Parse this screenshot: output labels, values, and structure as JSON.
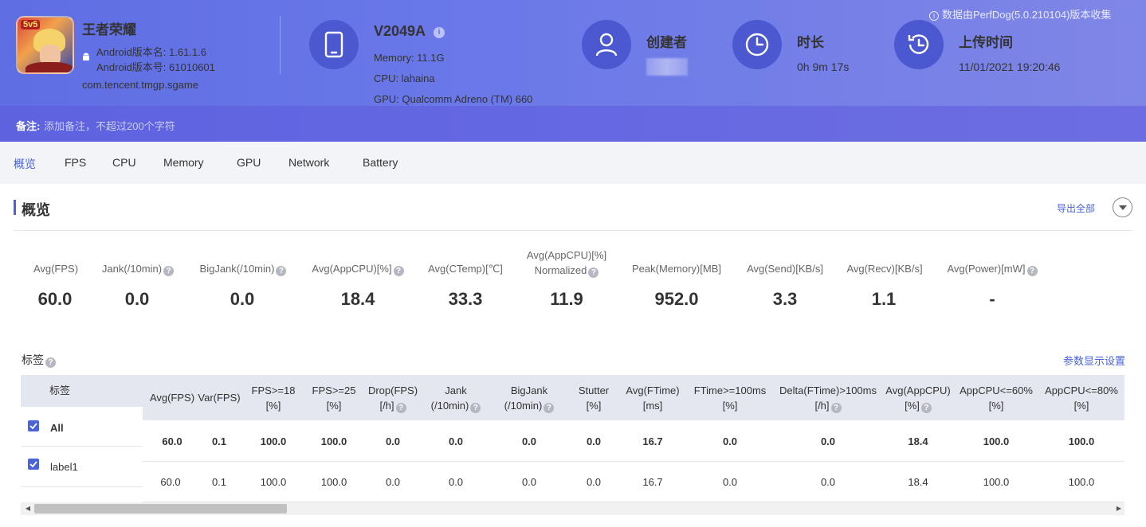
{
  "app": {
    "name": "王者荣耀",
    "badge": "5v5",
    "version_name": "Android版本名: 1.61.1.6",
    "version_code": "Android版本号: 61010601",
    "package": "com.tencent.tmgp.sgame"
  },
  "device": {
    "model": "V2049A",
    "memory": "Memory: 11.1G",
    "cpu": "CPU: lahaina",
    "gpu": "GPU: Qualcomm Adreno (TM) 660"
  },
  "creator": {
    "title": "创建者"
  },
  "duration": {
    "title": "时长",
    "value": "0h 9m 17s"
  },
  "upload": {
    "title": "上传时间",
    "value": "11/01/2021 19:20:46"
  },
  "collect_note": "数据由PerfDog(5.0.210104)版本收集",
  "remark": {
    "label": "备注:",
    "placeholder": "添加备注，不超过200个字符"
  },
  "tabs": [
    "概览",
    "FPS",
    "CPU",
    "Memory",
    "GPU",
    "Network",
    "Battery"
  ],
  "section": {
    "title": "概览",
    "export": "导出全部"
  },
  "stats": [
    {
      "label": "Avg(FPS)",
      "value": "60.0"
    },
    {
      "label": "Jank(/10min)",
      "value": "0.0"
    },
    {
      "label": "BigJank(/10min)",
      "value": "0.0"
    },
    {
      "label": "Avg(AppCPU)[%]",
      "value": "18.4"
    },
    {
      "label": "Avg(CTemp)[℃]",
      "value": "33.3"
    },
    {
      "label": "Avg(AppCPU)[%]",
      "label2": "Normalized",
      "value": "11.9"
    },
    {
      "label": "Peak(Memory)[MB]",
      "value": "952.0"
    },
    {
      "label": "Avg(Send)[KB/s]",
      "value": "3.3"
    },
    {
      "label": "Avg(Recv)[KB/s]",
      "value": "1.1"
    },
    {
      "label": "Avg(Power)[mW]",
      "value": "-"
    }
  ],
  "tags": {
    "title": "标签",
    "param_settings": "参数显示设置",
    "label_header": "标签",
    "columns": [
      {
        "l1": "Avg(FPS)",
        "l2": ""
      },
      {
        "l1": "Var(FPS)",
        "l2": ""
      },
      {
        "l1": "FPS>=18",
        "l2": "[%]"
      },
      {
        "l1": "FPS>=25",
        "l2": "[%]"
      },
      {
        "l1": "Drop(FPS)",
        "l2": "[/h]"
      },
      {
        "l1": "Jank",
        "l2": "(/10min)"
      },
      {
        "l1": "BigJank",
        "l2": "(/10min)"
      },
      {
        "l1": "Stutter",
        "l2": "[%]"
      },
      {
        "l1": "Avg(FTime)",
        "l2": "[ms]"
      },
      {
        "l1": "FTime>=100ms",
        "l2": "[%]"
      },
      {
        "l1": "Delta(FTime)>100ms",
        "l2": "[/h]"
      },
      {
        "l1": "Avg(AppCPU)",
        "l2": "[%]"
      },
      {
        "l1": "AppCPU<=60%",
        "l2": "[%]"
      },
      {
        "l1": "AppCPU<=80%",
        "l2": "[%]"
      }
    ],
    "rows": [
      {
        "label": "All",
        "values": [
          "60.0",
          "0.1",
          "100.0",
          "100.0",
          "0.0",
          "0.0",
          "0.0",
          "0.0",
          "16.7",
          "0.0",
          "0.0",
          "18.4",
          "100.0",
          "100.0"
        ]
      },
      {
        "label": "label1",
        "values": [
          "60.0",
          "0.1",
          "100.0",
          "100.0",
          "0.0",
          "0.0",
          "0.0",
          "0.0",
          "16.7",
          "0.0",
          "0.0",
          "18.4",
          "100.0",
          "100.0"
        ]
      }
    ]
  }
}
